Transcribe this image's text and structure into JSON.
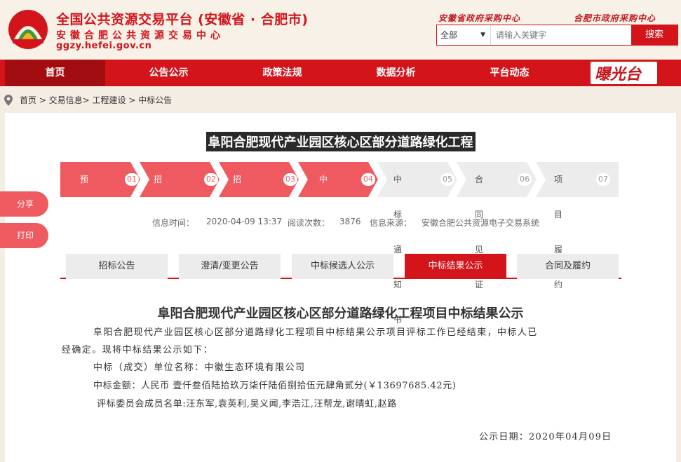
{
  "header": {
    "title": "全国公共资源交易平台 (安徽省 · 合肥市)",
    "subtitle": "安徽合肥公共资源交易中心",
    "url": "ggzy.hefei.gov.cn",
    "top_links": [
      "安徽省政府采购中心",
      "合肥市政府采购中心"
    ]
  },
  "search": {
    "select_value": "全部",
    "placeholder": "请输入关键字",
    "button_label": "搜索"
  },
  "nav": {
    "items": [
      "首页",
      "公告公示",
      "政策法规",
      "数据分析",
      "平台动态"
    ],
    "active_index": 0,
    "logo_text": "曝光台"
  },
  "breadcrumb": "首页 > 交易信息> 工程建设 > 中标公告",
  "project": {
    "title": "阜阳合肥现代产业园区核心区部分道路绿化工程"
  },
  "steps": [
    {
      "label": "预约场地",
      "num": "01",
      "active": true
    },
    {
      "label": "招标公告发布",
      "num": "02",
      "active": true
    },
    {
      "label": "招标文件发布",
      "num": "03",
      "active": true
    },
    {
      "label": "中标公示",
      "num": "04",
      "active": true
    },
    {
      "label": "中标通知书",
      "num": "05",
      "active": false
    },
    {
      "label": "合同见证",
      "num": "06",
      "active": false
    },
    {
      "label": "项目履约",
      "num": "07",
      "active": false
    }
  ],
  "meta": {
    "time_label": "信息时间：",
    "time_value": "2020-04-09 13:37",
    "views_label": "阅读次数：",
    "views_value": "3876",
    "source_label": "信息来源：",
    "source_value": "安徽合肥公共资源电子交易系统"
  },
  "side": {
    "share": "分享",
    "print": "打印"
  },
  "tabs": [
    "招标公告",
    "澄清/变更公告",
    "中标候选人公示",
    "中标结果公示",
    "合同及履约"
  ],
  "active_tab": 3,
  "content": {
    "title": "阜阳合肥现代产业园区核心区部分道路绿化工程项目中标结果公示",
    "intro_line1": "阜阳合肥现代产业园区核心区部分道路绿化工程项目中标结果公示项目评标工作已经结束，中标人已",
    "intro_line2": "经确定。现将中标结果公示如下：",
    "winner": "中标（成交）单位名称：中徽生态环境有限公司",
    "amount": "中标金额：人民币 壹仟叁佰陆拾玖万柒仟陆佰捌拾伍元肆角贰分(￥13697685.42元)",
    "committee": "评标委员会成员名单:汪东军,袁英利,吴义闻,李浩江,汪帮龙,谢晴虹,赵路",
    "date": "公示日期：2020年04月09日"
  }
}
